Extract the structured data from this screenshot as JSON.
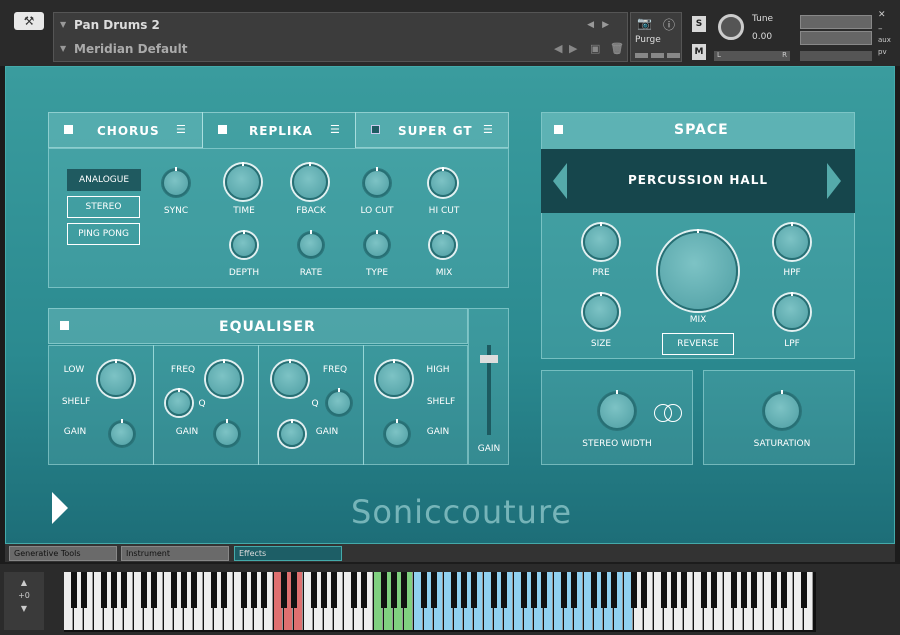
{
  "header": {
    "instrument_name": "Pan Drums 2",
    "preset_name": "Meridian Default",
    "purge_label": "Purge",
    "s_label": "S",
    "m_label": "M",
    "tune_label": "Tune",
    "tune_value": "0.00",
    "lr_left": "L",
    "lr_right": "R",
    "aux_label": "aux",
    "pv_label": "pv"
  },
  "chorus_tab": {
    "label": "CHORUS",
    "enabled": true
  },
  "replika_tab": {
    "label": "REPLIKA",
    "enabled": true
  },
  "supergt_tab": {
    "label": "SUPER GT",
    "enabled": false
  },
  "replika": {
    "mode_dropdown": "ANALOGUE",
    "stereo_button": "STEREO",
    "pingpong_button": "PING PONG",
    "knobs": [
      "SYNC",
      "TIME",
      "FBACK",
      "LO CUT",
      "HI CUT",
      "DEPTH",
      "RATE",
      "TYPE",
      "MIX"
    ]
  },
  "equaliser": {
    "title": "EQUALISER",
    "low_label": "LOW",
    "shelf_label": "SHELF",
    "gain_label": "GAIN",
    "freq_label": "FREQ",
    "q_label": "Q",
    "high_label": "HIGH",
    "fader_label": "GAIN"
  },
  "space": {
    "title": "SPACE",
    "preset": "PERCUSSION HALL",
    "pre_label": "PRE",
    "hpf_label": "HPF",
    "mix_label": "MIX",
    "size_label": "SIZE",
    "lpf_label": "LPF",
    "reverse_button": "REVERSE"
  },
  "stereo_width_label": "STEREO WIDTH",
  "saturation_label": "SATURATION",
  "brand": "Soniccouture",
  "bottom_tabs": [
    "Generative Tools",
    "Instrument",
    "Effects"
  ],
  "keyboard": {
    "octave": "+0"
  },
  "colors": {
    "accent": "#2b8a90",
    "active_tab": "#1d5e66",
    "key_red": "#e07070",
    "key_green": "#80d080",
    "key_blue": "#90d0f0"
  }
}
